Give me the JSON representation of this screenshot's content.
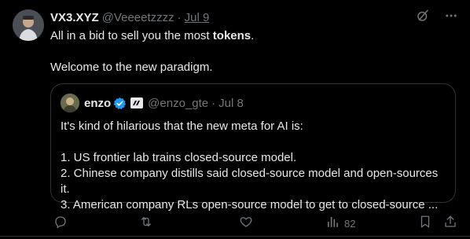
{
  "tweet": {
    "author_name": "VX3.XYZ",
    "author_handle": "@Veeeetzzzz",
    "separator": "·",
    "date": "Jul 9",
    "text_line1_prefix": "All in a bid to sell you the most ",
    "text_line1_bold": "tokens",
    "text_line1_suffix": ".",
    "text_line2": "Welcome to the new paradigm."
  },
  "quote": {
    "author_name": "enzo",
    "author_handle": "@enzo_gte",
    "separator": "·",
    "date": "Jul 8",
    "intro": "It's kind of hilarious that the new meta for AI is:",
    "items": [
      "1. US frontier lab trains closed-source model.",
      "2. Chinese company distills said closed-source model and open-sources it.",
      "3. American company RLs open-source model to get to closed-source ..."
    ]
  },
  "actions": {
    "views_count": "82"
  },
  "icons": {
    "top_actions": [
      "grok-icon",
      "more-icon"
    ],
    "bottom_actions": [
      "reply-icon",
      "retweet-icon",
      "like-icon",
      "views-icon",
      "bookmark-icon",
      "share-icon"
    ]
  },
  "colors": {
    "background": "#000000",
    "text_primary": "#e7e9ea",
    "text_secondary": "#71767b",
    "border": "#2f3336",
    "verified_blue": "#1d9bf0"
  }
}
